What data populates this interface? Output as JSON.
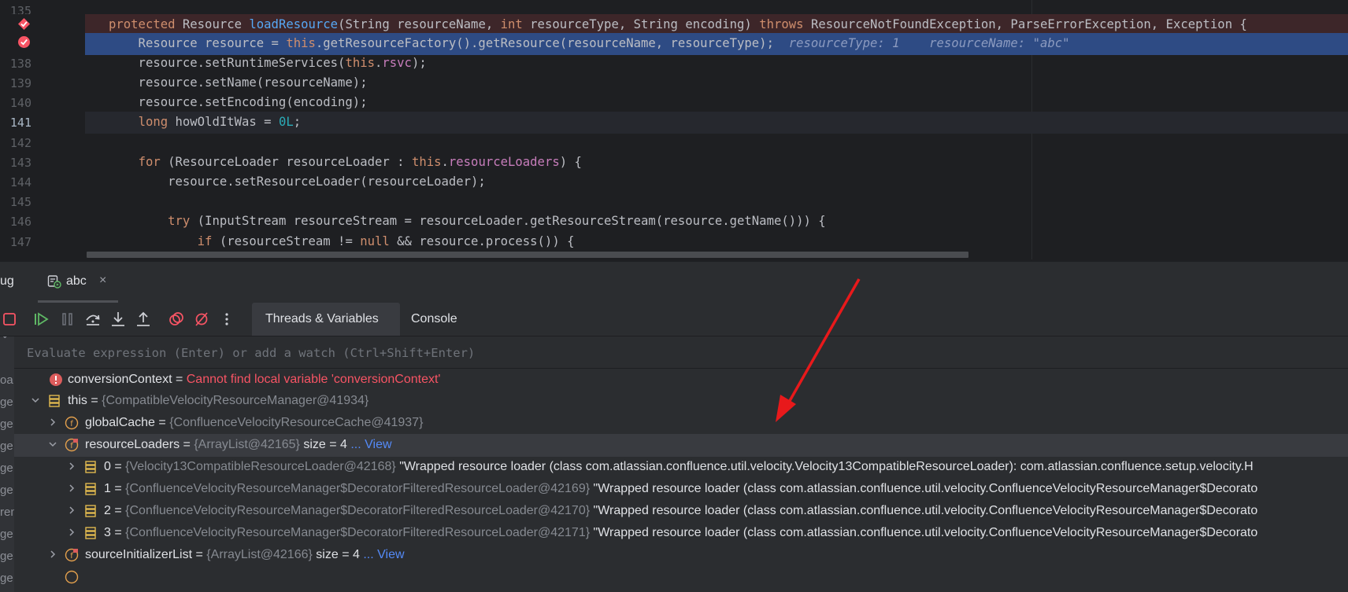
{
  "editor": {
    "lines": [
      {
        "num": "135",
        "code": ""
      },
      {
        "num": "",
        "code": "protected Resource loadResource(String resourceName, int resourceType, String encoding) throws ResourceNotFoundException, ParseErrorException, Exception {"
      },
      {
        "num": "",
        "code": "    Resource resource = this.getResourceFactory().getResource(resourceName, resourceType);",
        "hint1": "resourceType: 1",
        "hint2": "resourceName: \"abc\""
      },
      {
        "num": "138",
        "code": "    resource.setRuntimeServices(this.rsvc);"
      },
      {
        "num": "139",
        "code": "    resource.setName(resourceName);"
      },
      {
        "num": "140",
        "code": "    resource.setEncoding(encoding);"
      },
      {
        "num": "141",
        "code": "    long howOldItWas = 0L;"
      },
      {
        "num": "142",
        "code": ""
      },
      {
        "num": "143",
        "code": "    for (ResourceLoader resourceLoader : this.resourceLoaders) {"
      },
      {
        "num": "144",
        "code": "        resource.setResourceLoader(resourceLoader);"
      },
      {
        "num": "145",
        "code": ""
      },
      {
        "num": "146",
        "code": "        try (InputStream resourceStream = resourceLoader.getResourceStream(resource.getName())) {"
      },
      {
        "num": "147",
        "code": "            if (resourceStream != null && resource.process()) {"
      }
    ]
  },
  "debug": {
    "title": "ug",
    "session_tab": "abc",
    "close_glyph": "×",
    "tabs": {
      "threads": "Threads & Variables",
      "console": "Console"
    },
    "eval_placeholder": "Evaluate expression (Enter) or add a watch (Ctrl+Shift+Enter)",
    "left_fragments": [
      "oa",
      "ge",
      "ge",
      "ge",
      "ge",
      "ge",
      "ren",
      "ge",
      "ge",
      "ge"
    ]
  },
  "variables": [
    {
      "name": "conversionContext",
      "eq": " = ",
      "error": "Cannot find local variable 'conversionContext'"
    },
    {
      "name": "this",
      "eq": " = ",
      "type": "{CompatibleVelocityResourceManager@41934}"
    },
    {
      "name": "globalCache",
      "eq": " = ",
      "type": "{ConfluenceVelocityResourceCache@41937}"
    },
    {
      "name": "resourceLoaders",
      "eq": " = ",
      "type": "{ArrayList@42165}",
      "size": "size = 4",
      "view": "... View"
    },
    {
      "name": "0",
      "eq": " = ",
      "type": "{Velocity13CompatibleResourceLoader@42168}",
      "value": "\"Wrapped resource loader (class com.atlassian.confluence.util.velocity.Velocity13CompatibleResourceLoader): com.atlassian.confluence.setup.velocity.H"
    },
    {
      "name": "1",
      "eq": " = ",
      "type": "{ConfluenceVelocityResourceManager$DecoratorFilteredResourceLoader@42169}",
      "value": "\"Wrapped resource loader (class com.atlassian.confluence.util.velocity.ConfluenceVelocityResourceManager$Decorato"
    },
    {
      "name": "2",
      "eq": " = ",
      "type": "{ConfluenceVelocityResourceManager$DecoratorFilteredResourceLoader@42170}",
      "value": "\"Wrapped resource loader (class com.atlassian.confluence.util.velocity.ConfluenceVelocityResourceManager$Decorato"
    },
    {
      "name": "3",
      "eq": " = ",
      "type": "{ConfluenceVelocityResourceManager$DecoratorFilteredResourceLoader@42171}",
      "value": "\"Wrapped resource loader (class com.atlassian.confluence.util.velocity.ConfluenceVelocityResourceManager$Decorato"
    },
    {
      "name": "sourceInitializerList",
      "eq": " = ",
      "type": "{ArrayList@42166}",
      "size": "size = 4",
      "view": "... View"
    }
  ],
  "colors": {
    "annotation_arrow": "#e8191b",
    "exec_line": "#2e4b84",
    "breakpoint": "#f75464"
  }
}
